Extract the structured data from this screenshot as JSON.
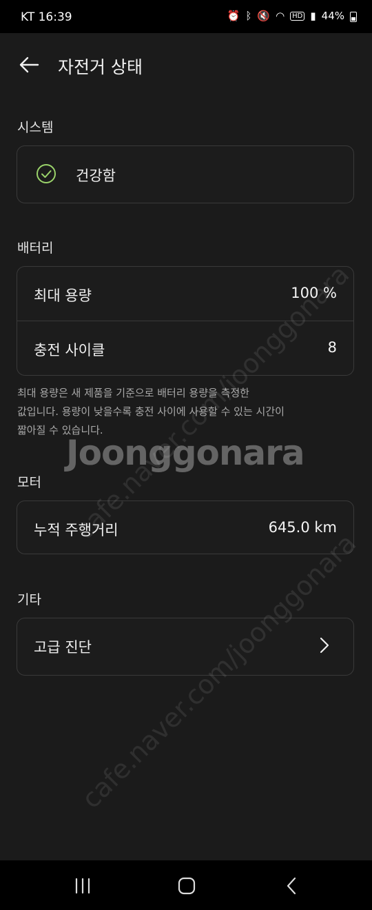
{
  "status_bar": {
    "carrier_time": "KT 16:39",
    "battery": "44%",
    "icons": [
      "alarm-icon",
      "bluetooth-icon",
      "mute-icon",
      "wifi-icon",
      "hd-icon",
      "signal-icon",
      "battery-icon"
    ]
  },
  "header": {
    "title": "자전거 상태"
  },
  "system": {
    "section": "시스템",
    "status": "건강함"
  },
  "battery": {
    "section": "배터리",
    "max_capacity_label": "최대 용량",
    "max_capacity_value": "100 %",
    "charge_cycles_label": "충전 사이클",
    "charge_cycles_value": "8",
    "note_line1": "최대 용량은 새 제품을 기준으로 배터리 용량을 측정한",
    "note_line2": "값입니다. 용량이 낮을수록 충전 사이에 사용할 수 있는 시간이",
    "note_line3": "짧아질 수 있습니다."
  },
  "motor": {
    "section": "모터",
    "odometer_label": "누적 주행거리",
    "odometer_value": "645.0 km"
  },
  "other": {
    "section": "기타",
    "advanced_label": "고급 진단"
  },
  "watermark": {
    "main": "Joonggonara",
    "diagonal": "cafe.naver.com/joonggonara"
  },
  "colors": {
    "background": "#1b1b1b",
    "accent_check": "#9bd46b",
    "border": "#3a3a3a"
  }
}
